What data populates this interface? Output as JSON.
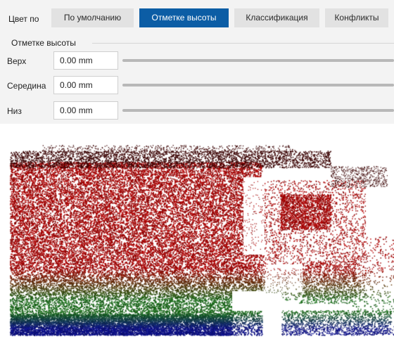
{
  "color_by": {
    "label": "Цвет по",
    "tabs": [
      {
        "label": "По умолчанию",
        "active": false
      },
      {
        "label": "Отметке высоты",
        "active": true
      },
      {
        "label": "Классификация",
        "active": false
      },
      {
        "label": "Конфликты",
        "active": false
      }
    ]
  },
  "elevation": {
    "group_title": "Отметке высоты",
    "rows": [
      {
        "label": "Верх",
        "value": "0.00 mm"
      },
      {
        "label": "Середина",
        "value": "0.00 mm"
      },
      {
        "label": "Низ",
        "value": "0.00 mm"
      }
    ]
  },
  "colors": {
    "accent": "#0c5da5",
    "high": "#c00000",
    "mid": "#1c7a1c",
    "low": "#10149a"
  }
}
